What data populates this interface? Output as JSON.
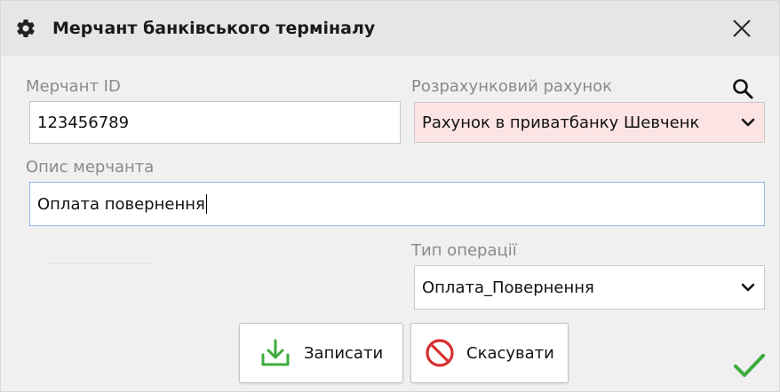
{
  "window": {
    "title": "Мерчант банківського терміналу"
  },
  "merchant_id": {
    "label": "Мерчант ID",
    "value": "123456789"
  },
  "account": {
    "label": "Розрахунковий рахунок",
    "value": "Рахунок в приватбанку Шевченк",
    "background": "#fce4e4"
  },
  "description": {
    "label": "Опис мерчанта",
    "value": "Оплата повернення"
  },
  "operation_type": {
    "label": "Тип операції",
    "value": "Оплата_Повернення"
  },
  "buttons": {
    "save_label": "Записати",
    "cancel_label": "Скасувати"
  },
  "colors": {
    "accent_green": "#3dab3d",
    "cancel_red": "#d93030",
    "focus_border": "#8fb5e8"
  },
  "icons": {
    "title": "gear-icon",
    "close": "close-icon",
    "search": "search-icon",
    "dropdown": "chevron-down-icon",
    "save": "download-icon",
    "cancel": "cancel-icon",
    "ok": "checkmark-icon"
  }
}
